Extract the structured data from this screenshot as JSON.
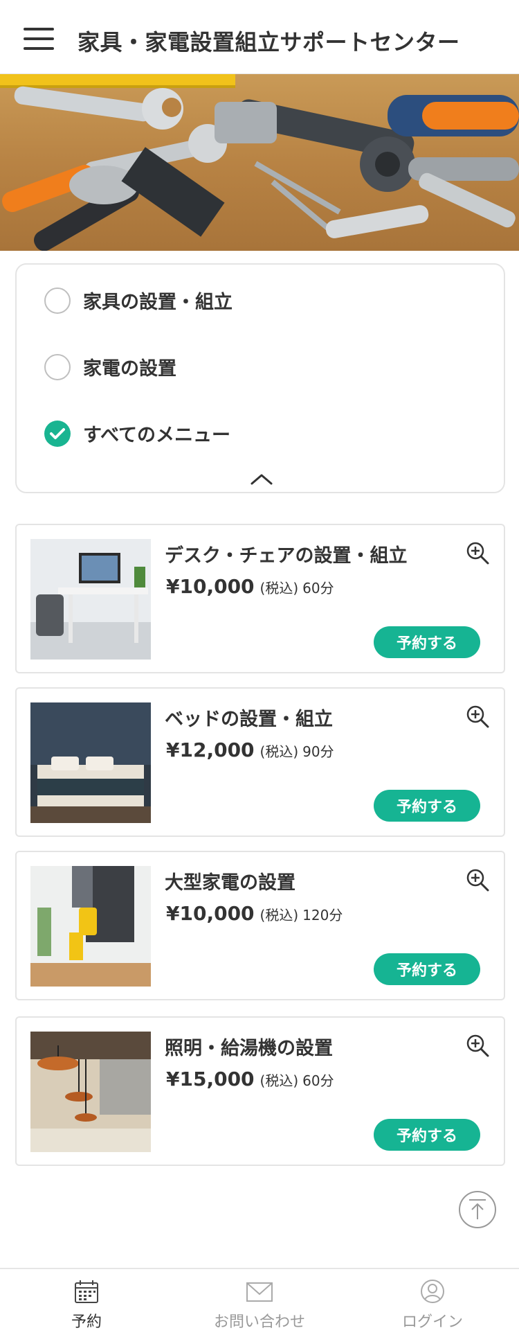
{
  "header": {
    "title": "家具・家電設置組立サポートセンター",
    "menu_icon": "hamburger-icon"
  },
  "filter": {
    "options": [
      {
        "label": "家具の設置・組立",
        "checked": false
      },
      {
        "label": "家電の設置",
        "checked": false
      },
      {
        "label": "すべてのメニュー",
        "checked": true
      }
    ],
    "toggle_icon": "chevron-up-icon"
  },
  "services": [
    {
      "title": "デスク・チェアの設置・組立",
      "price": "¥10,000",
      "tax": "(税込)",
      "duration": "60分",
      "button": "予約する"
    },
    {
      "title": "ベッドの設置・組立",
      "price": "¥12,000",
      "tax": "(税込)",
      "duration": "90分",
      "button": "予約する"
    },
    {
      "title": "大型家電の設置",
      "price": "¥10,000",
      "tax": "(税込)",
      "duration": "120分",
      "button": "予約する"
    },
    {
      "title": "照明・給湯機の設置",
      "price": "¥15,000",
      "tax": "(税込)",
      "duration": "60分",
      "button": "予約する"
    }
  ],
  "bottom_nav": [
    {
      "label": "予約",
      "icon": "calendar-icon",
      "active": true
    },
    {
      "label": "お問い合わせ",
      "icon": "mail-icon",
      "active": false
    },
    {
      "label": "ログイン",
      "icon": "user-icon",
      "active": false
    }
  ],
  "colors": {
    "accent": "#16b493",
    "text": "#333333",
    "border": "#e4e4e4",
    "muted": "#999999"
  }
}
